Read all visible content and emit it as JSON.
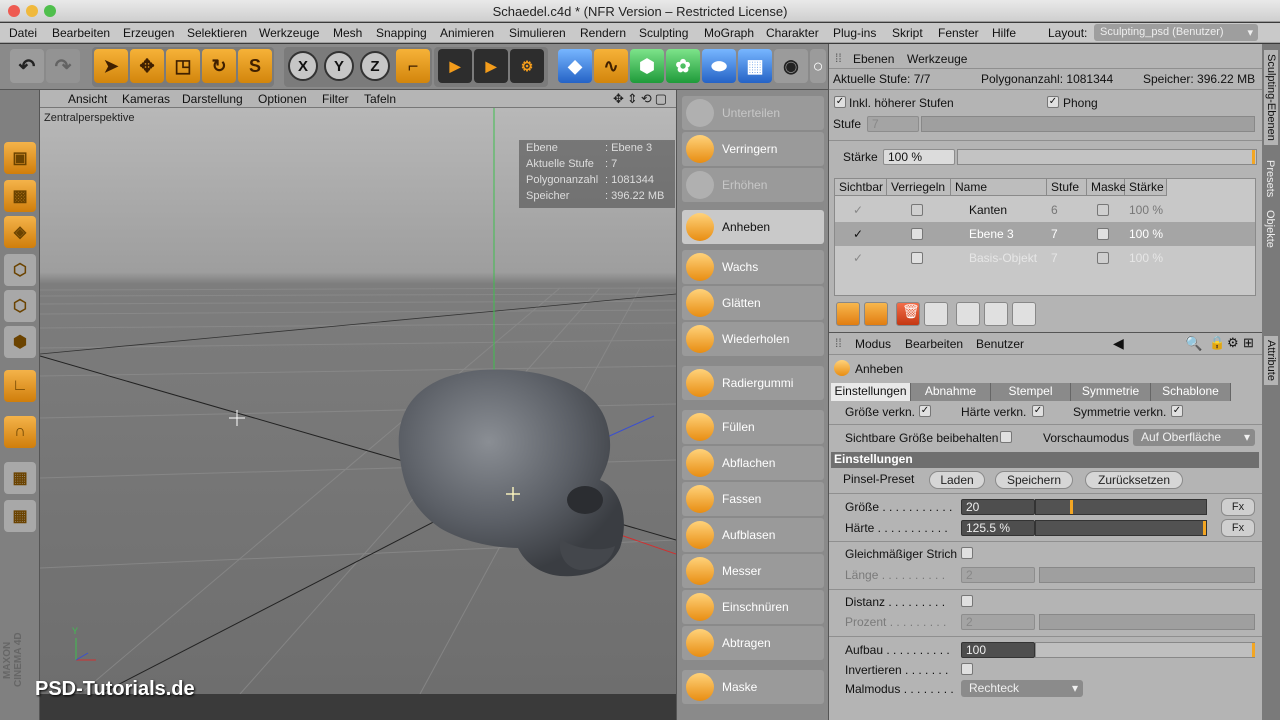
{
  "window": {
    "title": "Schaedel.c4d * (NFR Version – Restricted License)"
  },
  "menu": [
    "Datei",
    "Bearbeiten",
    "Erzeugen",
    "Selektieren",
    "Werkzeuge",
    "Mesh",
    "Snapping",
    "Animieren",
    "Simulieren",
    "Rendern",
    "Sculpting",
    "MoGraph",
    "Charakter",
    "Plug-ins",
    "Skript",
    "Fenster",
    "Hilfe"
  ],
  "layout": {
    "label": "Layout:",
    "value": "Sculpting_psd (Benutzer)"
  },
  "toolbar": {
    "x": "X",
    "y": "Y",
    "z": "Z"
  },
  "viewport": {
    "menu": [
      "Ansicht",
      "Kameras",
      "Darstellung",
      "Optionen",
      "Filter",
      "Tafeln"
    ],
    "label": "Zentralperspektive",
    "hud": [
      {
        "key": "Ebene",
        "val": "Ebene 3"
      },
      {
        "key": "Aktuelle Stufe",
        "val": "7"
      },
      {
        "key": "Polygonanzahl",
        "val": "1081344"
      },
      {
        "key": "Speicher",
        "val": "396.22 MB"
      }
    ],
    "axis_y": "Y",
    "brand": "PSD-Tutorials.de",
    "maxon": "MAXON CINEMA 4D"
  },
  "brushes": [
    {
      "label": "Unterteilen",
      "state": "dim"
    },
    {
      "label": "Verringern",
      "state": "normal"
    },
    {
      "label": "Erhöhen",
      "state": "dim"
    },
    {
      "label": "Anheben",
      "state": "active"
    },
    {
      "label": "Wachs",
      "state": "normal"
    },
    {
      "label": "Glätten",
      "state": "normal"
    },
    {
      "label": "Wiederholen",
      "state": "normal"
    },
    {
      "label": "Radiergummi",
      "state": "normal"
    },
    {
      "label": "Füllen",
      "state": "normal"
    },
    {
      "label": "Abflachen",
      "state": "normal"
    },
    {
      "label": "Fassen",
      "state": "normal"
    },
    {
      "label": "Aufblasen",
      "state": "normal"
    },
    {
      "label": "Messer",
      "state": "normal"
    },
    {
      "label": "Einschnüren",
      "state": "normal"
    },
    {
      "label": "Abtragen",
      "state": "normal"
    },
    {
      "label": "Maske",
      "state": "normal"
    }
  ],
  "layers_panel": {
    "tabs": [
      "Ebenen",
      "Werkzeuge"
    ],
    "aktuelle_stufe": "Aktuelle Stufe: 7/7",
    "polygonanzahl": "Polygonanzahl: 1081344",
    "speicher": "Speicher: 396.22 MB",
    "inkl": "Inkl. höherer Stufen",
    "phong": "Phong",
    "stufe_label": "Stufe",
    "stufe_value": "7",
    "staerke_label": "Stärke",
    "staerke_value": "100 %",
    "columns": [
      "Sichtbar",
      "Verriegeln",
      "Name",
      "Stufe",
      "Maske",
      "Stärke"
    ],
    "rows": [
      {
        "name": "Kanten",
        "stufe": "6",
        "staerke": "100 %"
      },
      {
        "name": "Ebene 3",
        "stufe": "7",
        "staerke": "100 %"
      },
      {
        "name": "Basis-Objekt",
        "stufe": "7",
        "staerke": "100 %"
      }
    ]
  },
  "attributes": {
    "menu": [
      "Modus",
      "Bearbeiten",
      "Benutzer"
    ],
    "tool_name": "Anheben",
    "tabs": [
      "Einstellungen",
      "Abnahme",
      "Stempel",
      "Symmetrie",
      "Schablone"
    ],
    "groesse_verkn": "Größe verkn.",
    "haerte_verkn": "Härte verkn.",
    "symmetrie_verkn": "Symmetrie verkn.",
    "sichtbare": "Sichtbare Größe beibehalten",
    "vorschaumodus_label": "Vorschaumodus",
    "vorschaumodus_value": "Auf Oberfläche",
    "section": "Einstellungen",
    "pinsel_preset": "Pinsel-Preset",
    "laden": "Laden",
    "speichern": "Speichern",
    "zuruecksetzen": "Zurücksetzen",
    "groesse_label": "Größe . . . . . . . . . . .",
    "groesse_value": "20",
    "groesse_level": 0.2,
    "haerte_label": "Härte . . . . . . . . . . .",
    "haerte_value": "125.5 %",
    "haerte_level": 0.99,
    "fx": "Fx",
    "gleich": "Gleichmäßiger Strich",
    "laenge_label": "Länge . . . . . . . . . .",
    "laenge_value": "2",
    "distanz_label": "Distanz . . . . . . . . .",
    "prozent_label": "Prozent . . . . . . . . .",
    "prozent_value": "2",
    "aufbau_label": "Aufbau . . . . . . . . . .",
    "aufbau_value": "100",
    "invertieren_label": "Invertieren . . . . . . .",
    "malmodus_label": "Malmodus . . . . . . . .",
    "malmodus_value": "Rechteck"
  },
  "side_tabs": [
    "Sculpting-Ebenen",
    "Presets",
    "Objekte",
    "Attribute"
  ],
  "colors": {
    "accent": "#f3a623",
    "panel": "#b4b4b4",
    "toolbar": "#8a8a8a"
  }
}
